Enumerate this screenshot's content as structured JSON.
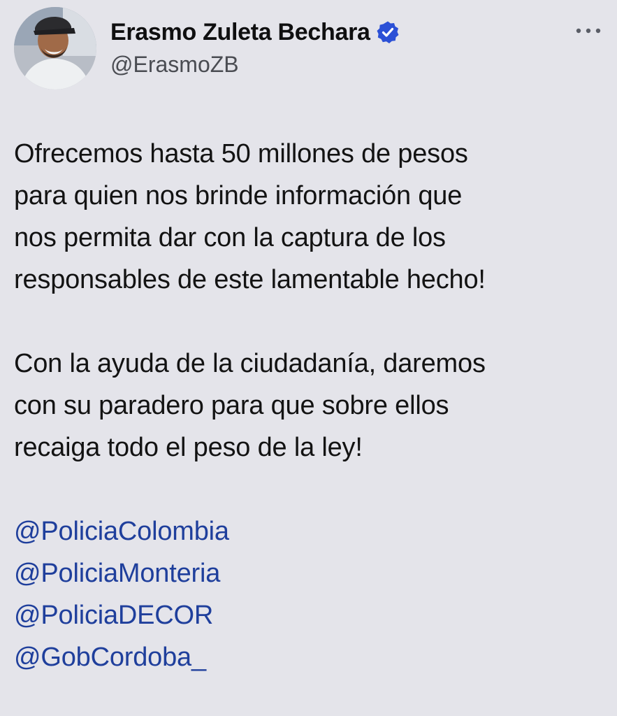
{
  "header": {
    "display_name": "Erasmo Zuleta Bechara",
    "handle": "@ErasmoZB",
    "verified": true,
    "verified_badge_icon": "verified-badge-icon",
    "more_icon": "more-horizontal-icon",
    "avatar_icon": "avatar-photo"
  },
  "tweet": {
    "paragraph1": [
      "Ofrecemos hasta 50 millones de pesos",
      "para quien nos brinde información que",
      "nos permita dar con la captura de los",
      "responsables de este lamentable hecho!"
    ],
    "paragraph2": [
      "Con la ayuda de la ciudadanía, daremos",
      "con su paradero para que sobre ellos",
      "recaiga todo el peso de la ley!"
    ],
    "mentions": [
      "@PoliciaColombia",
      "@PoliciaMonteria",
      "@PoliciaDECOR",
      "@GobCordoba_"
    ]
  },
  "colors": {
    "background": "#e4e4ea",
    "mention": "#1f3f9c",
    "verified_badge": "#2b50d6"
  }
}
